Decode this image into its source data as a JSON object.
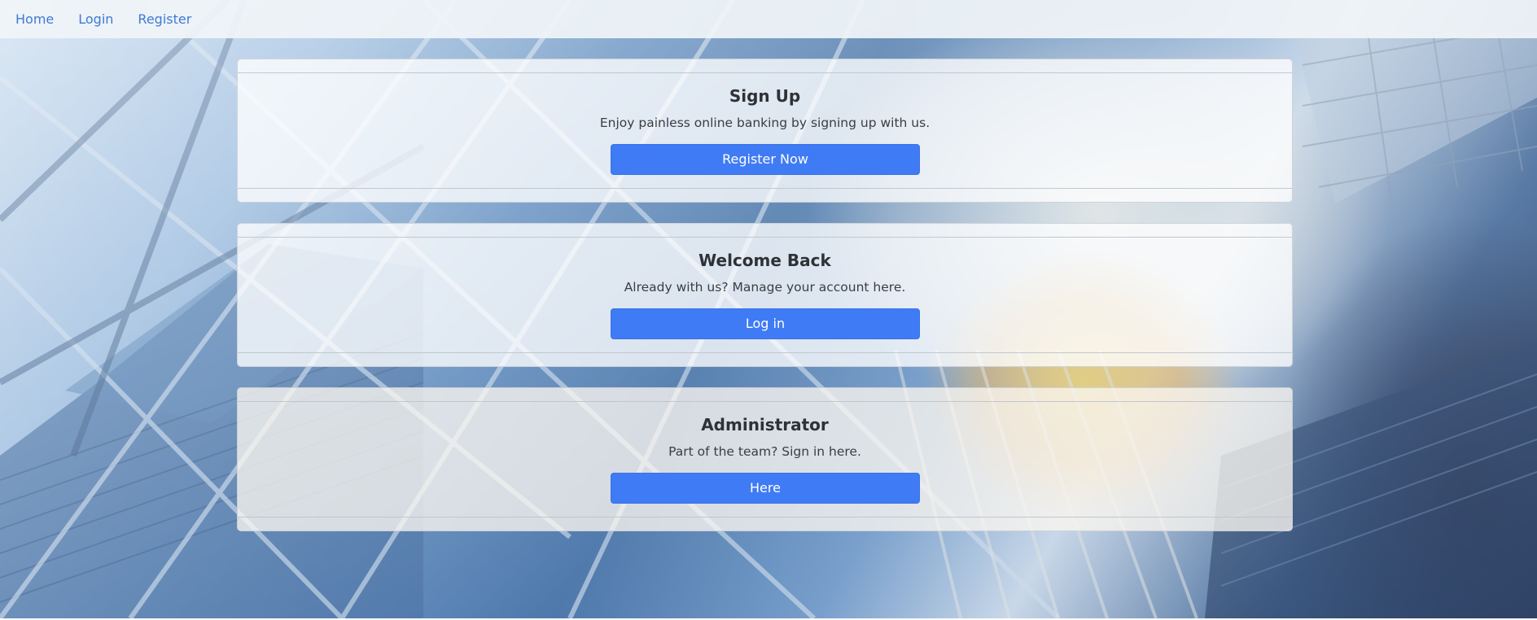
{
  "nav": {
    "links": [
      {
        "label": "Home"
      },
      {
        "label": "Login"
      },
      {
        "label": "Register"
      }
    ],
    "link_color": "#3f7ad6"
  },
  "cards": [
    {
      "title": "Sign Up",
      "text": "Enjoy painless online banking by signing up with us.",
      "button_label": "Register Now"
    },
    {
      "title": "Welcome Back",
      "text": "Already with us? Manage your account here.",
      "button_label": "Log in"
    },
    {
      "title": "Administrator",
      "text": "Part of the team? Sign in here.",
      "button_label": "Here"
    }
  ],
  "colors": {
    "button_primary": "#3f7bf4",
    "title_text": "#2e3236"
  }
}
